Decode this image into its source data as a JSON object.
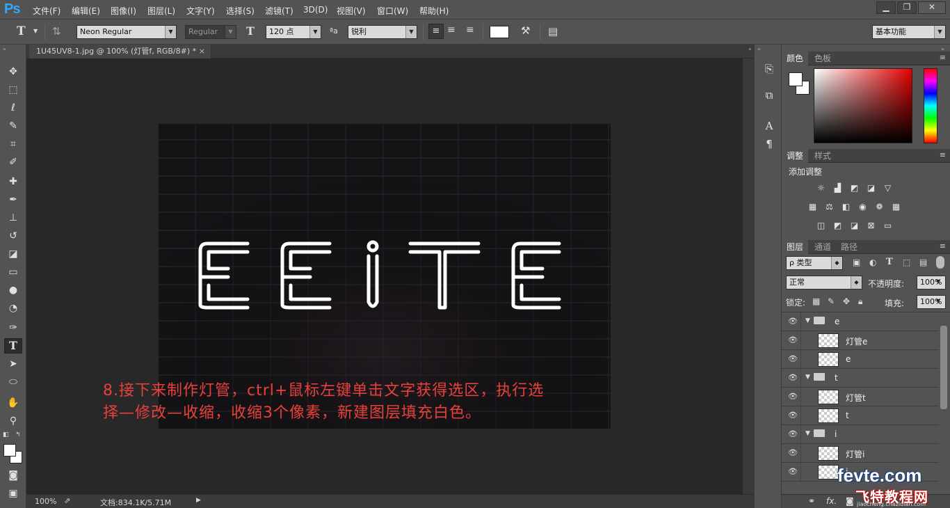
{
  "app": {
    "logo": "Ps"
  },
  "menu": [
    "文件(F)",
    "编辑(E)",
    "图像(I)",
    "图层(L)",
    "文字(Y)",
    "选择(S)",
    "滤镜(T)",
    "3D(D)",
    "视图(V)",
    "窗口(W)",
    "帮助(H)"
  ],
  "window": {
    "min": "▁",
    "max": "❐",
    "close": "✕"
  },
  "options": {
    "tool_glyph": "T",
    "font_family": "Neon Regular",
    "font_style": "Regular",
    "size_glyph": "T",
    "font_size": "120 点",
    "aa_glyph": "ªa",
    "antialias": "锐利",
    "workspace": "基本功能"
  },
  "document": {
    "tab_title": "1U45UV8-1.jpg @ 100% (灯管f, RGB/8#) *",
    "tab_close": "×",
    "zoom": "100%",
    "doc_info": "文档:834.1K/5.71M",
    "neon_text": "EEITE"
  },
  "annotation": {
    "line1": "8.接下来制作灯管，ctrl+鼠标左键单击文字获得选区，执行选",
    "line2": "择—修改—收缩，收缩3个像素，新建图层填充白色。"
  },
  "panels": {
    "color_tabs": [
      "颜色",
      "色板"
    ],
    "adjust_tabs": [
      "调整",
      "样式"
    ],
    "adjust_title": "添加调整",
    "layer_tabs": [
      "图层",
      "通道",
      "路径"
    ],
    "filter_kind": "ρ 类型",
    "blend_mode": "正常",
    "opacity_label": "不透明度:",
    "opacity": "100%",
    "lock_label": "锁定:",
    "fill_label": "填充:",
    "fill": "100%"
  },
  "layers": [
    {
      "name": "e",
      "type": "group"
    },
    {
      "name": "灯管e",
      "type": "layer"
    },
    {
      "name": "e",
      "type": "layer"
    },
    {
      "name": "t",
      "type": "group"
    },
    {
      "name": "灯管t",
      "type": "layer"
    },
    {
      "name": "t",
      "type": "layer"
    },
    {
      "name": "i",
      "type": "group"
    },
    {
      "name": "灯管i",
      "type": "layer"
    },
    {
      "name": "i",
      "type": "layer"
    }
  ],
  "watermark": {
    "line1": "fevte.com",
    "line2": "飞特教程网",
    "line3": "jiaocheng.chazidian.com"
  },
  "colors": {
    "annotation": "#e8403a",
    "ps_blue": "#31a8ff",
    "bg": "#282828"
  }
}
